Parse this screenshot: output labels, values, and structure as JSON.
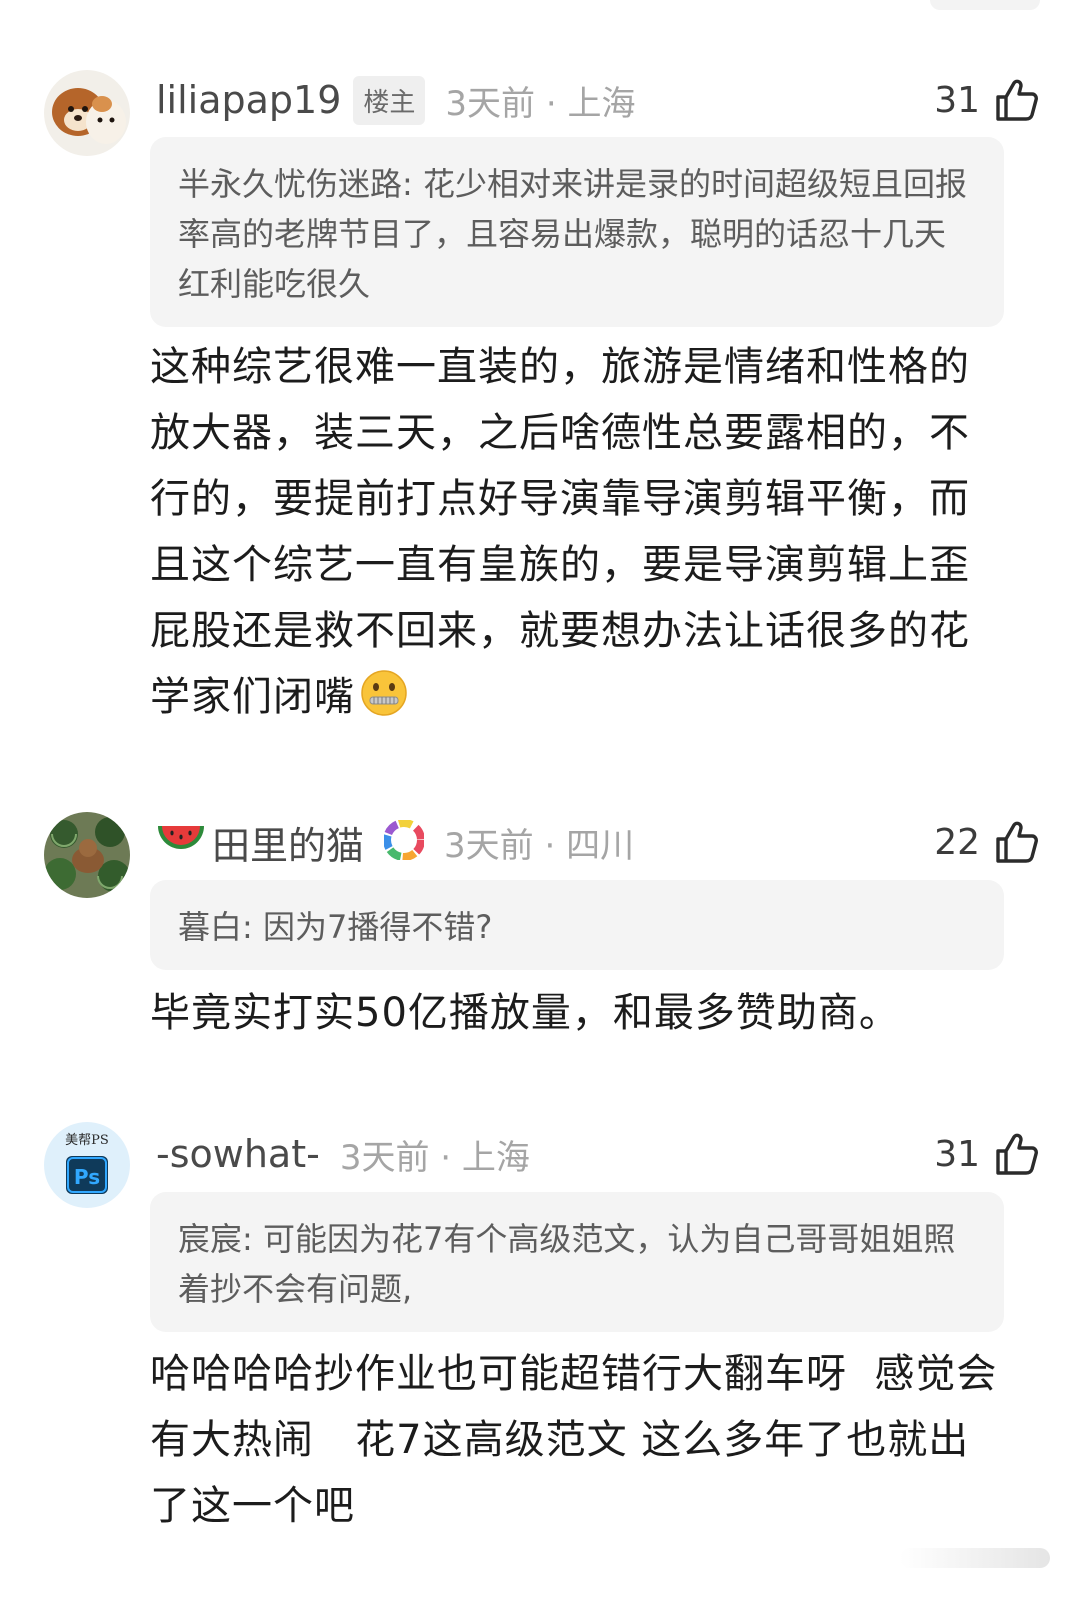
{
  "comments": [
    {
      "username": "liliapap19",
      "badge": "楼主",
      "meta": "3天前 · 上海",
      "likes": "31",
      "quote_author": "半永久忧伤迷路:",
      "quote_text": " 花少相对来讲是录的时间超级短且回报率高的老牌节目了，且容易出爆款，聪明的话忍十几天红利能吃很久",
      "reply": "这种综艺很难一直装的，旅游是情绪和性格的放大器，装三天，之后啥德性总要露相的，不行的，要提前打点好导演靠导演剪辑平衡，而且这个综艺一直有皇族的，要是导演剪辑上歪屁股还是救不回来，就要想办法让话很多的花学家们闭嘴",
      "reply_emoji": "zipper-mouth-face-icon"
    },
    {
      "username": "田里的猫",
      "username_icon": "watermelon-icon",
      "badge_icon": "rainbow-donut-badge-icon",
      "meta": "3天前 · 四川",
      "likes": "22",
      "quote_author": "暮白:",
      "quote_text": " 因为7播得不错?",
      "reply": "毕竟实打实50亿播放量，和最多赞助商。"
    },
    {
      "username": "-sowhat-",
      "meta": "3天前 · 上海",
      "likes": "31",
      "avatar_text": "美帮PS",
      "avatar_logo": "Ps",
      "quote_author": "宸宸:",
      "quote_text": " 可能因为花7有个高级范文，认为自己哥哥姐姐照着抄不会有问题,",
      "reply": "哈哈哈哈抄作业也可能超错行大翻车呀  感觉会有大热闹   花7这高级范文 这么多年了也就出了这一个吧"
    }
  ]
}
